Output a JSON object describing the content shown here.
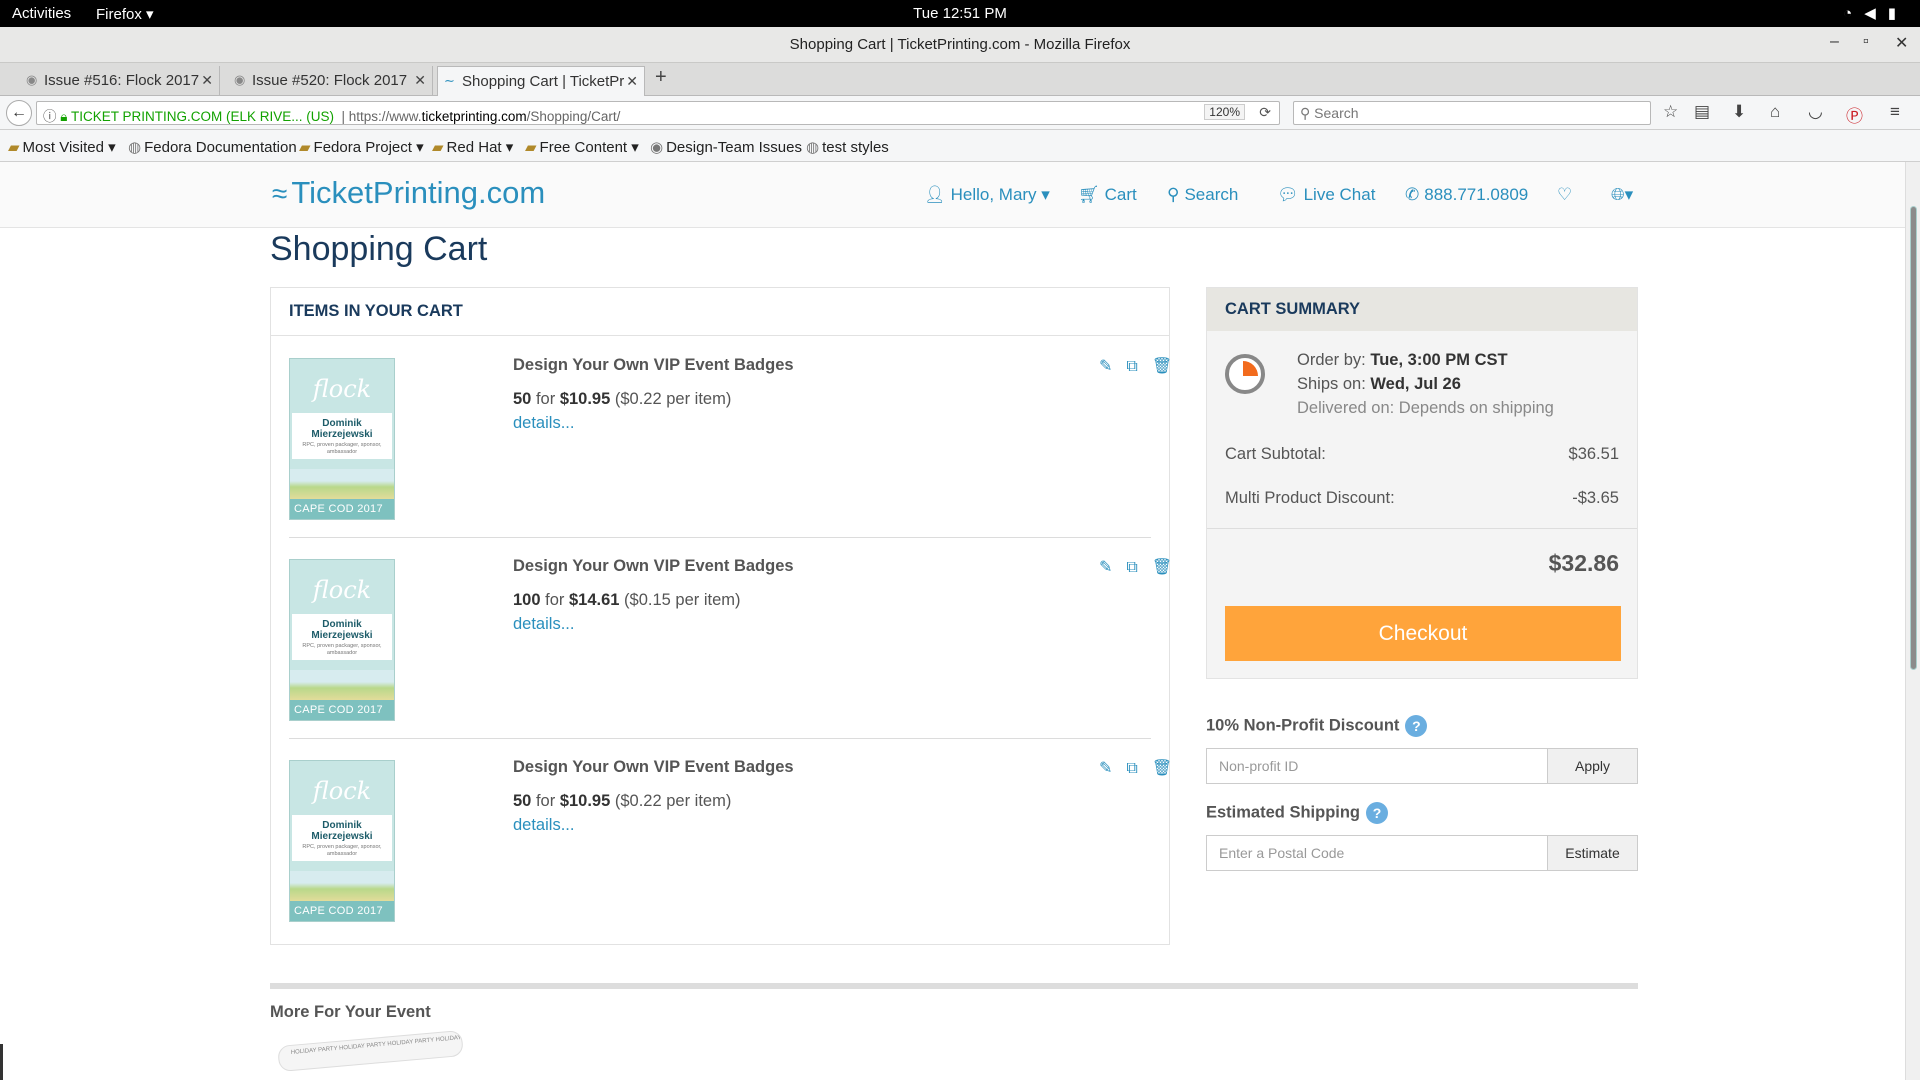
{
  "gnome": {
    "activities": "Activities",
    "app": "Firefox ▾",
    "clock": "Tue 12:51 PM"
  },
  "window": {
    "title": "Shopping Cart | TicketPrinting.com - Mozilla Firefox"
  },
  "tabs": [
    {
      "label": "Issue #516: Flock 2017",
      "active": false
    },
    {
      "label": "Issue #520: Flock 2017",
      "active": false
    },
    {
      "label": "Shopping Cart | TicketPr",
      "active": true
    }
  ],
  "urlbar": {
    "identity": "TICKET PRINTING.COM (ELK RIVE... (US)",
    "url_prefix": "https://www.",
    "url_host": "ticketprinting.com",
    "url_path": "/Shopping/Cart/",
    "zoom": "120%"
  },
  "search": {
    "placeholder": "Search"
  },
  "bookmarks": [
    "Most Visited",
    "Fedora Documentation",
    "Fedora Project",
    "Red Hat",
    "Free Content",
    "Design-Team Issues",
    "test styles"
  ],
  "site": {
    "logo": "TicketPrinting.com",
    "nav": {
      "hello": "Hello, Mary",
      "cart": "Cart",
      "search": "Search",
      "chat": "Live Chat",
      "phone": "888.771.0809"
    }
  },
  "page_title": "Shopping Cart",
  "items_panel": {
    "header": "ITEMS IN YOUR CART",
    "items": [
      {
        "name": "Design Your Own VIP Event Badges",
        "qty": "50",
        "for": "for",
        "price": "$10.95",
        "unit": "($0.22 per item)",
        "details": "details..."
      },
      {
        "name": "Design Your Own VIP Event Badges",
        "qty": "100",
        "for": "for",
        "price": "$14.61",
        "unit": "($0.15 per item)",
        "details": "details..."
      },
      {
        "name": "Design Your Own VIP Event Badges",
        "qty": "50",
        "for": "for",
        "price": "$10.95",
        "unit": "($0.22 per item)",
        "details": "details..."
      }
    ],
    "thumb": {
      "brand": "flock",
      "person": "Dominik Mierzejewski",
      "role": "RPC, proven packager, sponsor, ambassador",
      "footer": "CAPE COD 2017"
    }
  },
  "summary": {
    "header": "CART SUMMARY",
    "order_by_label": "Order by:",
    "order_by": "Tue, 3:00 PM CST",
    "ships_label": "Ships on:",
    "ships": "Wed, Jul 26",
    "delivered": "Delivered on: Depends on shipping",
    "subtotal_label": "Cart Subtotal:",
    "subtotal": "$36.51",
    "discount_label": "Multi Product Discount:",
    "discount": "-$3.65",
    "total": "$32.86",
    "checkout": "Checkout"
  },
  "nonprofit": {
    "label": "10% Non-Profit Discount",
    "placeholder": "Non-profit ID",
    "button": "Apply"
  },
  "shipping": {
    "label": "Estimated Shipping",
    "placeholder": "Enter a Postal Code",
    "button": "Estimate"
  },
  "more": {
    "title": "More For Your Event",
    "lanyard_text": "HOLIDAY PARTY HOLIDAY PARTY HOLIDAY PARTY HOLIDAY PARTY"
  },
  "colors": {
    "accent": "#2a8fbd",
    "checkout": "#ffa43b",
    "heading": "#1a3a5c"
  }
}
